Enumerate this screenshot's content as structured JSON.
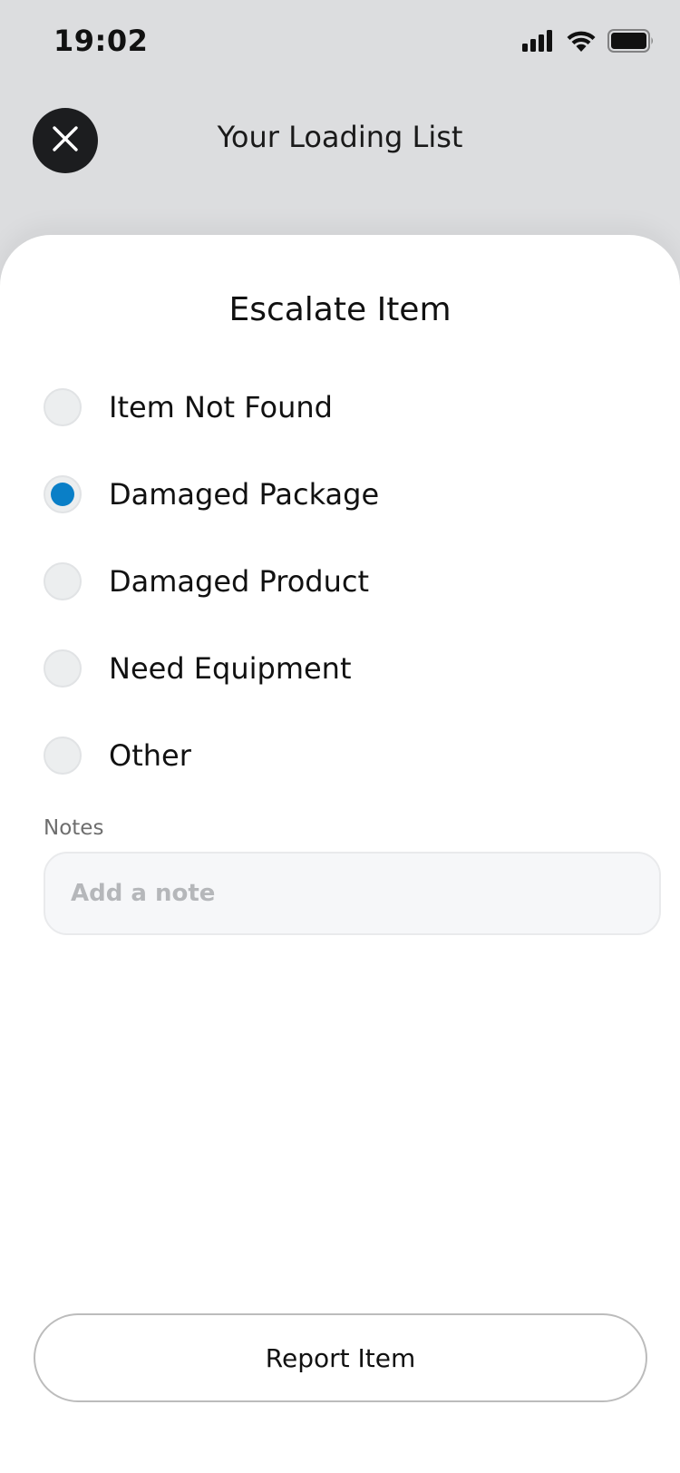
{
  "status_bar": {
    "time": "19:02",
    "icons": [
      "signal-icon",
      "wifi-icon",
      "battery-icon"
    ]
  },
  "header": {
    "title": "Your Loading List",
    "close_icon": "close-icon"
  },
  "sheet": {
    "title": "Escalate Item",
    "options": [
      {
        "label": "Item Not Found",
        "selected": false
      },
      {
        "label": "Damaged Package",
        "selected": true
      },
      {
        "label": "Damaged Product",
        "selected": false
      },
      {
        "label": "Need Equipment",
        "selected": false
      },
      {
        "label": "Other",
        "selected": false
      }
    ],
    "notes": {
      "label": "Notes",
      "placeholder": "Add a note",
      "value": ""
    },
    "submit_label": "Report Item"
  },
  "colors": {
    "accent": "#0a7fc7",
    "background": "#dcdddf",
    "sheet": "#ffffff",
    "close_button": "#1c1d1f"
  }
}
